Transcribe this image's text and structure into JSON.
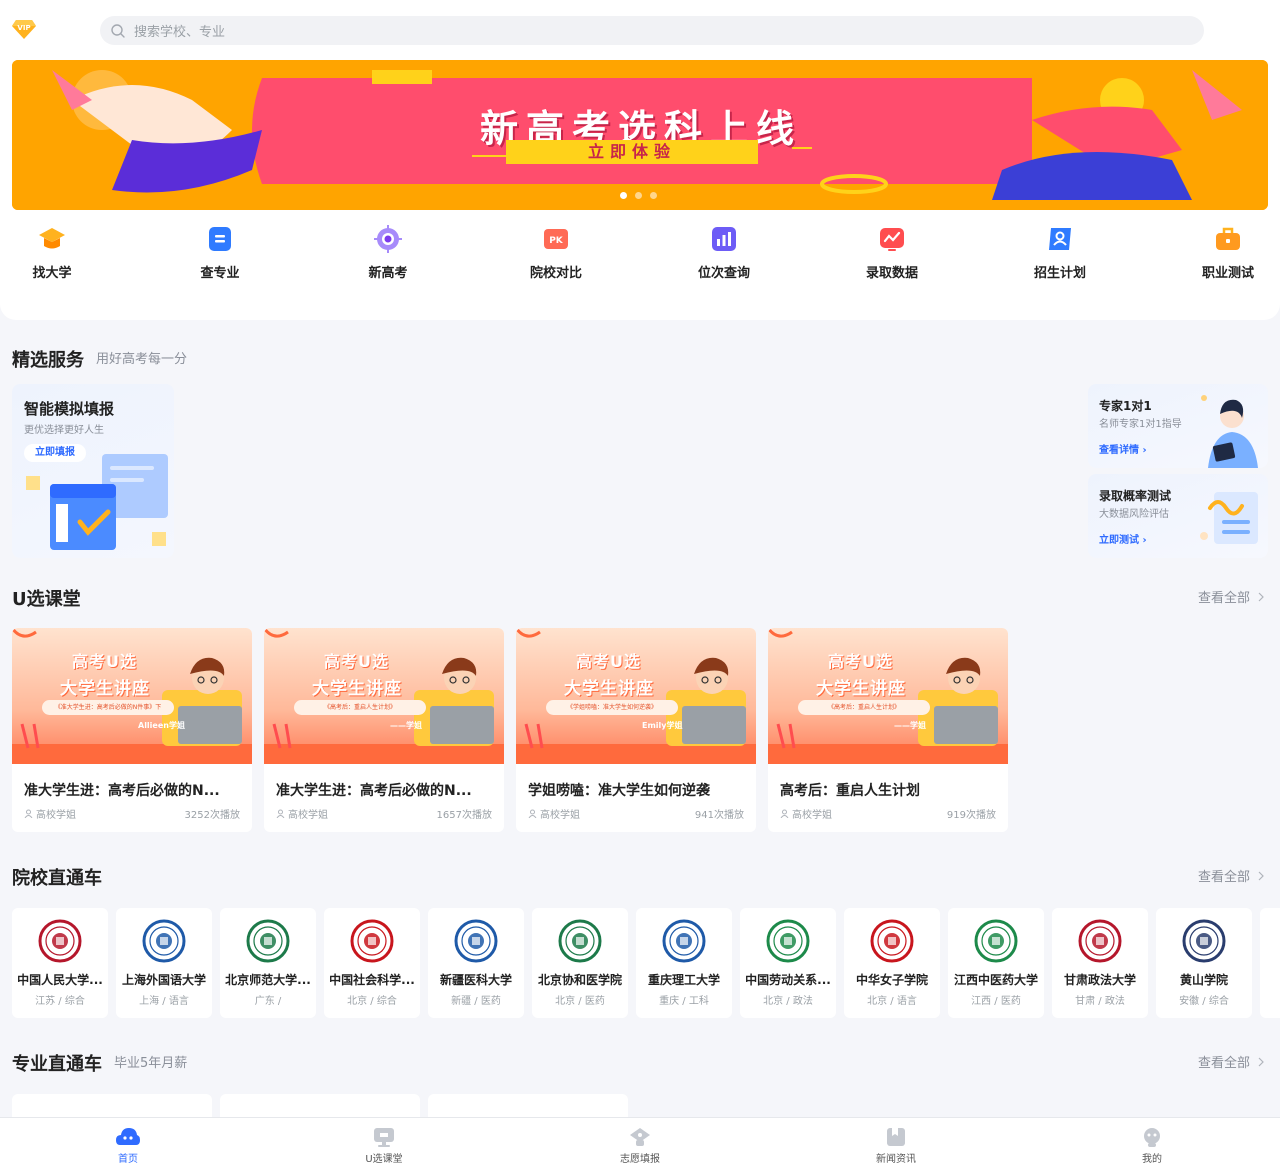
{
  "header": {
    "vip_badge": "VIP",
    "search_placeholder": "搜索学校、专业"
  },
  "banner": {
    "title": "新高考选科上线",
    "button": "立即体验",
    "slide_count": 3,
    "active_slide": 1
  },
  "nav": [
    {
      "label": "找大学",
      "icon": "school-hat-icon",
      "color": "#ff9a1f"
    },
    {
      "label": "查专业",
      "icon": "book-icon",
      "color": "#2f7bff"
    },
    {
      "label": "新高考",
      "icon": "compass-icon",
      "color": "#8b5cf6"
    },
    {
      "label": "院校对比",
      "icon": "pk-icon",
      "color": "#ff6a55"
    },
    {
      "label": "位次查询",
      "icon": "bar-chart-icon",
      "color": "#6d5cf6"
    },
    {
      "label": "录取数据",
      "icon": "trend-chart-icon",
      "color": "#ff4d4f"
    },
    {
      "label": "招生计划",
      "icon": "person-card-icon",
      "color": "#2f7bff"
    },
    {
      "label": "职业测试",
      "icon": "briefcase-icon",
      "color": "#ff9a1f"
    }
  ],
  "services": {
    "title": "精选服务",
    "subtitle": "用好高考每一分",
    "main": {
      "title": "智能模拟填报",
      "subtitle": "更优选择更好人生",
      "button": "立即填报"
    },
    "expert": {
      "title": "专家1对1",
      "subtitle": "名师专家1对1指导",
      "link": "查看详情 ›"
    },
    "probability": {
      "title": "录取概率测试",
      "subtitle": "大数据风险评估",
      "link": "立即测试 ›"
    }
  },
  "courses": {
    "title": "U选课堂",
    "see_all": "查看全部",
    "items": [
      {
        "thumb_line1": "高考U选",
        "thumb_line2": "大学生讲座",
        "thumb_pill": "《准大学生进：高考后必做的N件事》下",
        "thumb_sig": "Allieen学姐",
        "title": "准大学生进：高考后必做的N...",
        "author": "高校学姐",
        "plays": "3252次播放"
      },
      {
        "thumb_line1": "高考U选",
        "thumb_line2": "大学生讲座",
        "thumb_pill": "《高考后：重启人生计划》",
        "thumb_sig": "——学姐",
        "title": "准大学生进：高考后必做的N...",
        "author": "高校学姐",
        "plays": "1657次播放"
      },
      {
        "thumb_line1": "高考U选",
        "thumb_line2": "大学生讲座",
        "thumb_pill": "《学姐唠嗑：准大学生如何逆袭》",
        "thumb_sig": "Emily学姐",
        "title": "学姐唠嗑：准大学生如何逆袭",
        "author": "高校学姐",
        "plays": "941次播放"
      },
      {
        "thumb_line1": "高考U选",
        "thumb_line2": "大学生讲座",
        "thumb_pill": "《高考后：重启人生计划》",
        "thumb_sig": "——学姐",
        "title": "高考后：重启人生计划",
        "author": "高校学姐",
        "plays": "919次播放"
      }
    ]
  },
  "schools": {
    "title": "院校直通车",
    "see_all": "查看全部",
    "items": [
      {
        "name": "中国人民大学...",
        "meta": "江苏 / 综合",
        "color": "#b5172c"
      },
      {
        "name": "上海外国语大学",
        "meta": "上海 / 语言",
        "color": "#1f5aa8"
      },
      {
        "name": "北京师范大学...",
        "meta": "广东 /",
        "color": "#1d7a4a"
      },
      {
        "name": "中国社会科学...",
        "meta": "北京 / 综合",
        "color": "#c8161d"
      },
      {
        "name": "新疆医科大学",
        "meta": "新疆 / 医药",
        "color": "#1f5aa8"
      },
      {
        "name": "北京协和医学院",
        "meta": "北京 / 医药",
        "color": "#1d7a4a"
      },
      {
        "name": "重庆理工大学",
        "meta": "重庆 / 工科",
        "color": "#1f5aa8"
      },
      {
        "name": "中国劳动关系...",
        "meta": "北京 / 政法",
        "color": "#1d8a4a"
      },
      {
        "name": "中华女子学院",
        "meta": "北京 / 语言",
        "color": "#c8161d"
      },
      {
        "name": "江西中医药大学",
        "meta": "江西 / 医药",
        "color": "#1d8a4a"
      },
      {
        "name": "甘肃政法大学",
        "meta": "甘肃 / 政法",
        "color": "#b5172c"
      },
      {
        "name": "黄山学院",
        "meta": "安徽 / 综合",
        "color": "#2a3d6e"
      }
    ]
  },
  "majors": {
    "title": "专业直通车",
    "subtitle": "毕业5年月薪",
    "see_all": "查看全部"
  },
  "tabbar": [
    {
      "label": "首页",
      "icon": "home-icon",
      "active": true
    },
    {
      "label": "U选课堂",
      "icon": "classroom-icon",
      "active": false
    },
    {
      "label": "志愿填报",
      "icon": "application-icon",
      "active": false
    },
    {
      "label": "新闻资讯",
      "icon": "news-icon",
      "active": false
    },
    {
      "label": "我的",
      "icon": "profile-icon",
      "active": false
    }
  ],
  "colors": {
    "accent": "#2f6bff",
    "banner_orange": "#ffa400",
    "banner_pink": "#ff4d6d"
  }
}
